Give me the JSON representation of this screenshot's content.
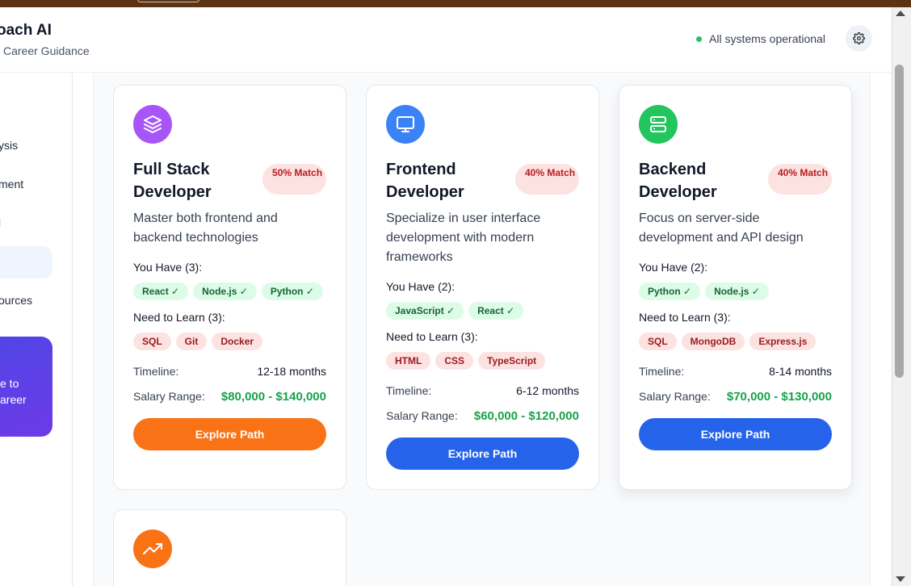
{
  "header": {
    "brand_title": "oach AI",
    "brand_subtitle": "Career Guidance",
    "status_text": "All systems operational",
    "settings_icon": "gear-icon"
  },
  "sidebar": {
    "items": [
      "ysis",
      "ment",
      "l",
      "ources"
    ],
    "promo_lines": [
      "e to",
      "areer"
    ]
  },
  "labels": {
    "timeline": "Timeline:",
    "salary": "Salary Range:"
  },
  "colors": {
    "status_green": "#22c55e",
    "salary_green": "#16a34a",
    "badge_bg": "#fde2e2",
    "orange": "#f97316",
    "blue": "#2563eb"
  },
  "cards": [
    {
      "icon": "layers-icon",
      "icon_color": "#a855f7",
      "title": "Full Stack Developer",
      "match": "50% Match",
      "description": "Master both frontend and backend technologies",
      "have_label": "You Have (3):",
      "have": [
        "React ✓",
        "Node.js ✓",
        "Python ✓"
      ],
      "learn_label": "Need to Learn (3):",
      "learn": [
        "SQL",
        "Git",
        "Docker"
      ],
      "timeline": "12-18 months",
      "salary": "$80,000 - $140,000",
      "cta": "Explore Path",
      "cta_color": "#f97316"
    },
    {
      "icon": "monitor-icon",
      "icon_color": "#3b82f6",
      "title": "Frontend Developer",
      "match": "40% Match",
      "description": "Specialize in user interface development with modern frameworks",
      "have_label": "You Have (2):",
      "have": [
        "JavaScript ✓",
        "React ✓"
      ],
      "learn_label": "Need to Learn (3):",
      "learn": [
        "HTML",
        "CSS",
        "TypeScript"
      ],
      "timeline": "6-12 months",
      "salary": "$60,000 - $120,000",
      "cta": "Explore Path",
      "cta_color": "#2563eb"
    },
    {
      "icon": "server-icon",
      "icon_color": "#22c55e",
      "title": "Backend Developer",
      "match": "40% Match",
      "description": "Focus on server-side development and API design",
      "have_label": "You Have (2):",
      "have": [
        "Python ✓",
        "Node.js ✓"
      ],
      "learn_label": "Need to Learn (3):",
      "learn": [
        "SQL",
        "MongoDB",
        "Express.js"
      ],
      "timeline": "8-14 months",
      "salary": "$70,000 - $130,000",
      "cta": "Explore Path",
      "cta_color": "#2563eb"
    },
    {
      "icon": "trending-up-icon",
      "icon_color": "#f97316"
    }
  ]
}
